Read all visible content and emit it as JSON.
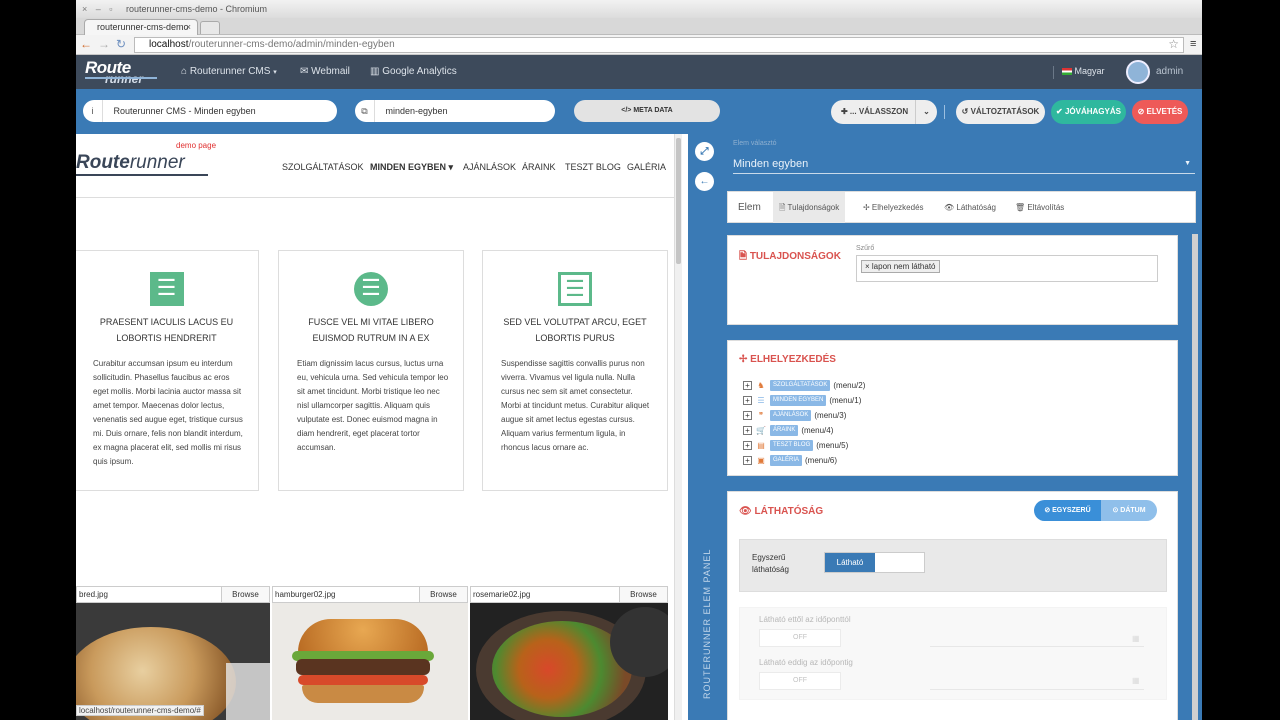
{
  "window": {
    "controls": "× – ▫",
    "title": "routerunner-cms-demo - Chromium"
  },
  "tabs": [
    {
      "title": "routerunner-cms-demo",
      "close": "×"
    }
  ],
  "address": {
    "back": "←",
    "forward": "→",
    "reload": "↻",
    "host": "localhost",
    "path": "/routerunner-cms-demo/admin/minden-egyben",
    "star": "☆",
    "menu": "≡"
  },
  "cmsnav": {
    "logo_top": "Route",
    "logo_bottom": "runner",
    "links": [
      {
        "icon": "⌂",
        "label": "Routerunner CMS",
        "caret": "▾"
      },
      {
        "icon": "✉",
        "label": "Webmail"
      },
      {
        "icon": "▥",
        "label": "Google Analytics"
      }
    ],
    "lang": "Magyar",
    "user": "admin"
  },
  "toolbar": {
    "title_icon": "i",
    "title_value": "Routerunner CMS - Minden egyben",
    "slug_icon": "⧉",
    "slug_value": "minden-egyben",
    "meta_label": "</> META DATA",
    "choose_label": "✚ ... VÁLASSZON",
    "choose_caret": "⌄",
    "changes_label": "↺ VÁLTOZTATÁSOK",
    "approve_label": "✔ JÓVÁHAGYÁS",
    "reject_label": "⊘ ELVETÉS"
  },
  "site": {
    "demo_label": "demo page",
    "logo_a": "Route",
    "logo_b": "runner",
    "nav": [
      "SZOLGÁLTATÁSOK",
      "MINDEN EGYBEN ▾",
      "AJÁNLÁSOK",
      "ÁRAINK",
      "TESZT BLOG",
      "GALÉRIA"
    ],
    "cards": [
      {
        "icon": "☰",
        "title": "PRAESENT IACULIS LACUS EU LOBORTIS HENDRERIT",
        "body": "Curabitur accumsan ipsum eu interdum sollicitudin. Phasellus faucibus ac eros eget mollis. Morbi lacinia auctor massa sit amet tempor. Maecenas dolor lectus, venenatis sed augue eget, tristique cursus mi. Duis ornare, felis non blandit interdum, ex magna placerat elit, sed mollis mi risus quis ipsum."
      },
      {
        "icon": "☰",
        "title": "FUSCE VEL MI VITAE LIBERO EUISMOD RUTRUM IN A EX",
        "body": "Etiam dignissim lacus cursus, luctus urna eu, vehicula urna. Sed vehicula tempor leo sit amet tincidunt. Morbi tristique leo nec nisl ullamcorper sagittis. Aliquam quis vulputate est. Donec euismod magna in diam hendrerit, eget placerat tortor accumsan."
      },
      {
        "icon": "☰",
        "title": "SED VEL VOLUTPAT ARCU, EGET LOBORTIS PURUS",
        "body": "Suspendisse sagittis convallis purus non viverra. Vivamus vel ligula nulla. Nulla cursus nec sem sit amet consectetur. Morbi at tincidunt metus. Curabitur aliquet augue sit amet lectus egestas cursus. Aliquam varius fermentum ligula, in rhoncus lacus ornare ac."
      }
    ],
    "uploads": [
      {
        "file": "bred.jpg",
        "browse": "Browse"
      },
      {
        "file": "hamburger02.jpg",
        "browse": "Browse"
      },
      {
        "file": "rosemarie02.jpg",
        "browse": "Browse"
      }
    ],
    "status_url": "localhost/routerunner-cms-demo/#"
  },
  "panel": {
    "vertical_title": "ROUTERUNNER ELEM PANEL",
    "expand_icon": "⤢",
    "back_icon": "←",
    "selector_label": "Elem választó",
    "selector_value": "Minden egyben",
    "selector_caret": "▼",
    "tabs": [
      "Elem",
      "🗎 Tulajdonságok",
      "✢ Elhelyezkedés",
      "👁 Láthatóság",
      "🗑 Eltávolítás"
    ],
    "props": {
      "title": "🗎 TULAJDONSÁGOK",
      "filter_label": "Szűrő",
      "filter_tag": "× lapon nem látható"
    },
    "placement": {
      "title": "✢ ELHELYEZKEDÉS",
      "tree": [
        {
          "icon": "♞",
          "label": "SZOLGÁLTATÁSOK",
          "ref": "(menu/2)"
        },
        {
          "icon": "☰",
          "label": "MINDEN EGYBEN",
          "ref": "(menu/1)"
        },
        {
          "icon": "❞",
          "label": "AJÁNLÁSOK",
          "ref": "(menu/3)"
        },
        {
          "icon": "🛒",
          "label": "ÁRAINK",
          "ref": "(menu/4)"
        },
        {
          "icon": "▤",
          "label": "TESZT BLOG",
          "ref": "(menu/5)"
        },
        {
          "icon": "▣",
          "label": "GALÉRIA",
          "ref": "(menu/6)"
        }
      ]
    },
    "visibility": {
      "title": "👁 LÁTHATÓSÁG",
      "seg_simple": "⊘ EGYSZERŰ",
      "seg_date": "⊙ DÁTUM",
      "simple_label": "Egyszerű láthatóság",
      "toggle_on": "Látható",
      "from_label": "Látható ettől az időponttól",
      "until_label": "Látható eddig az időpontig",
      "off": "OFF"
    }
  }
}
